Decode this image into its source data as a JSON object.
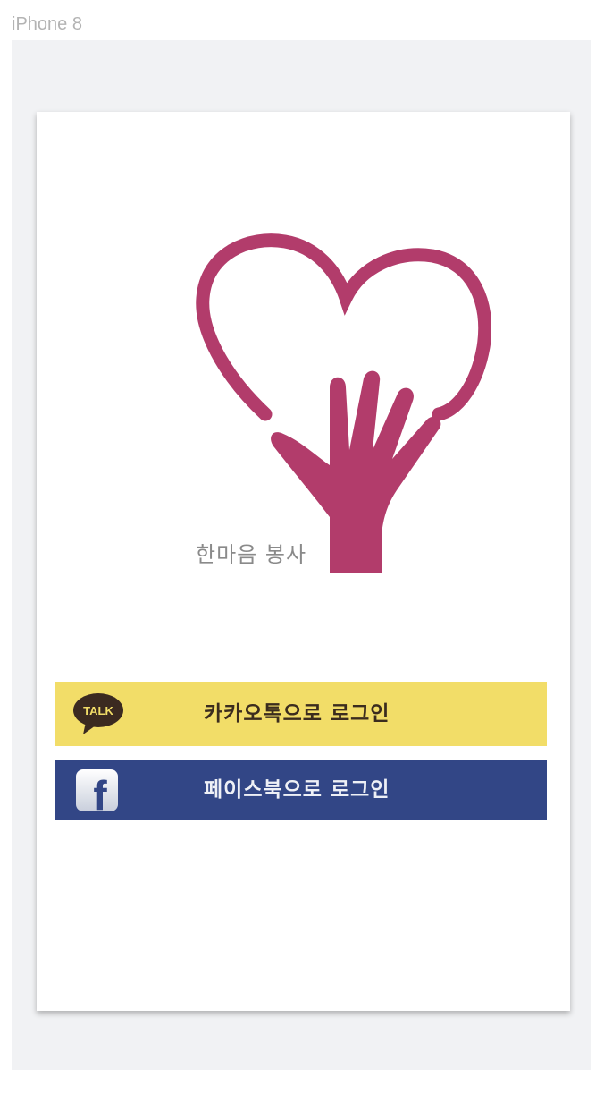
{
  "device": {
    "label": "iPhone 8"
  },
  "logo": {
    "caption": "한마음 봉사",
    "icon": "heart-hand-icon",
    "color": "#b23c6b"
  },
  "login": {
    "kakao": {
      "label": "카카오톡으로 로그인",
      "icon": "kakaotalk-icon",
      "icon_text": "TALK",
      "background": "#f2dd68"
    },
    "facebook": {
      "label": "페이스북으로 로그인",
      "icon": "facebook-icon",
      "icon_text": "f",
      "background": "#324686"
    }
  }
}
